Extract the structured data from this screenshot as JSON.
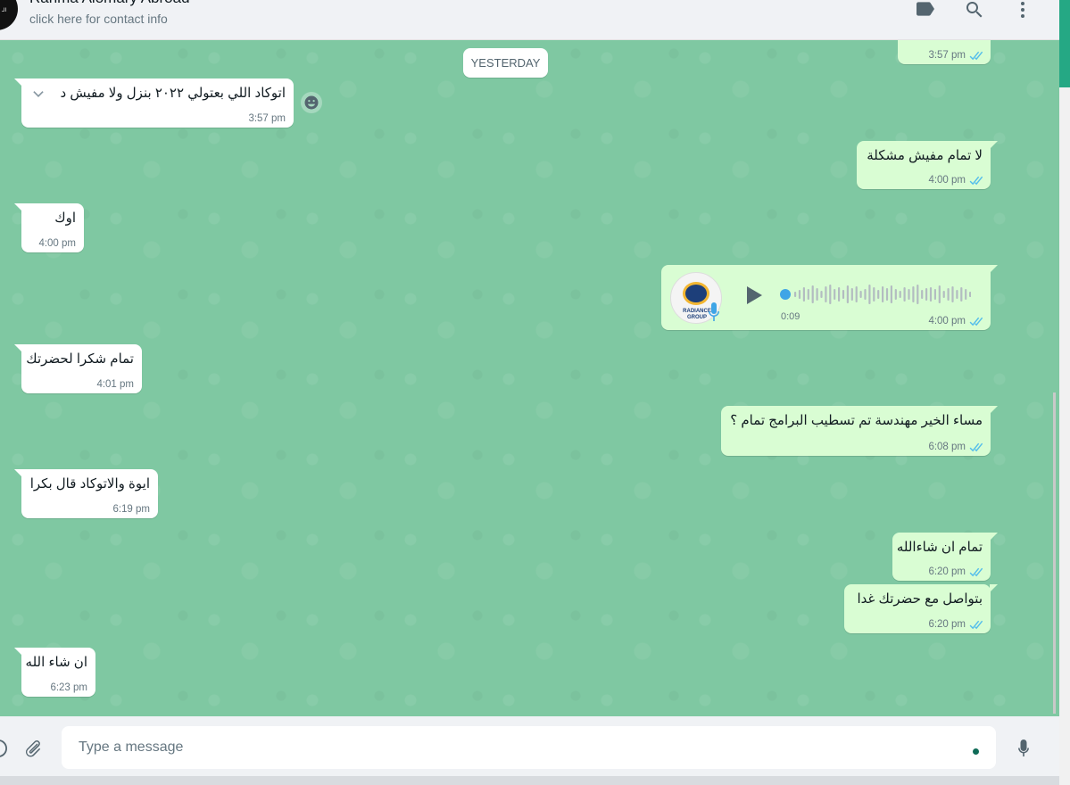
{
  "header": {
    "contact_name": "Rahma Alomary Abroad",
    "contact_sub": "click here for contact info",
    "avatar_text": "الـ"
  },
  "date_divider": "YESTERDAY",
  "messages": [
    {
      "dir": "out",
      "text": "",
      "time": "3:57 pm",
      "ticks": true
    },
    {
      "dir": "in",
      "text": "اتوكاد اللي بعتولي ٢٠٢٢ بنزل ولا مفيش د",
      "time": "3:57 pm"
    },
    {
      "dir": "out",
      "text": "لا تمام مفيش مشكلة",
      "time": "4:00 pm",
      "ticks": true
    },
    {
      "dir": "in",
      "text": "اوك",
      "time": "4:00 pm"
    },
    {
      "dir": "out",
      "type": "voice",
      "duration": "0:09",
      "time": "4:00 pm",
      "ticks": true,
      "logo_text": "RADIANCE GROUP"
    },
    {
      "dir": "in",
      "text": "تمام شكرا لحضرتك",
      "time": "4:01 pm"
    },
    {
      "dir": "out",
      "text": "مساء الخير مهندسة تم تسطيب البرامج تمام ؟",
      "time": "6:08 pm",
      "ticks": true
    },
    {
      "dir": "in",
      "text": "ايوة والاتوكاد قال بكرا",
      "time": "6:19 pm"
    },
    {
      "dir": "out",
      "text": "تمام ان شاءالله",
      "time": "6:20 pm",
      "ticks": true
    },
    {
      "dir": "out",
      "text": "بتواصل مع حضرتك غدا",
      "time": "6:20 pm",
      "ticks": true
    },
    {
      "dir": "in",
      "text": "ان شاء الله",
      "time": "6:23 pm"
    }
  ],
  "composer": {
    "placeholder": "Type a message"
  },
  "icons": {
    "header": [
      "label-icon",
      "search-icon",
      "menu-icon"
    ],
    "composer": [
      "emoji-icon",
      "attach-icon",
      "mic-icon"
    ]
  },
  "colors": {
    "chat_bg": "#7fc8a2",
    "outgoing_bubble": "#d9fdd3",
    "incoming_bubble": "#ffffff",
    "read_tick": "#53bdeb",
    "accent": "#25a884"
  }
}
